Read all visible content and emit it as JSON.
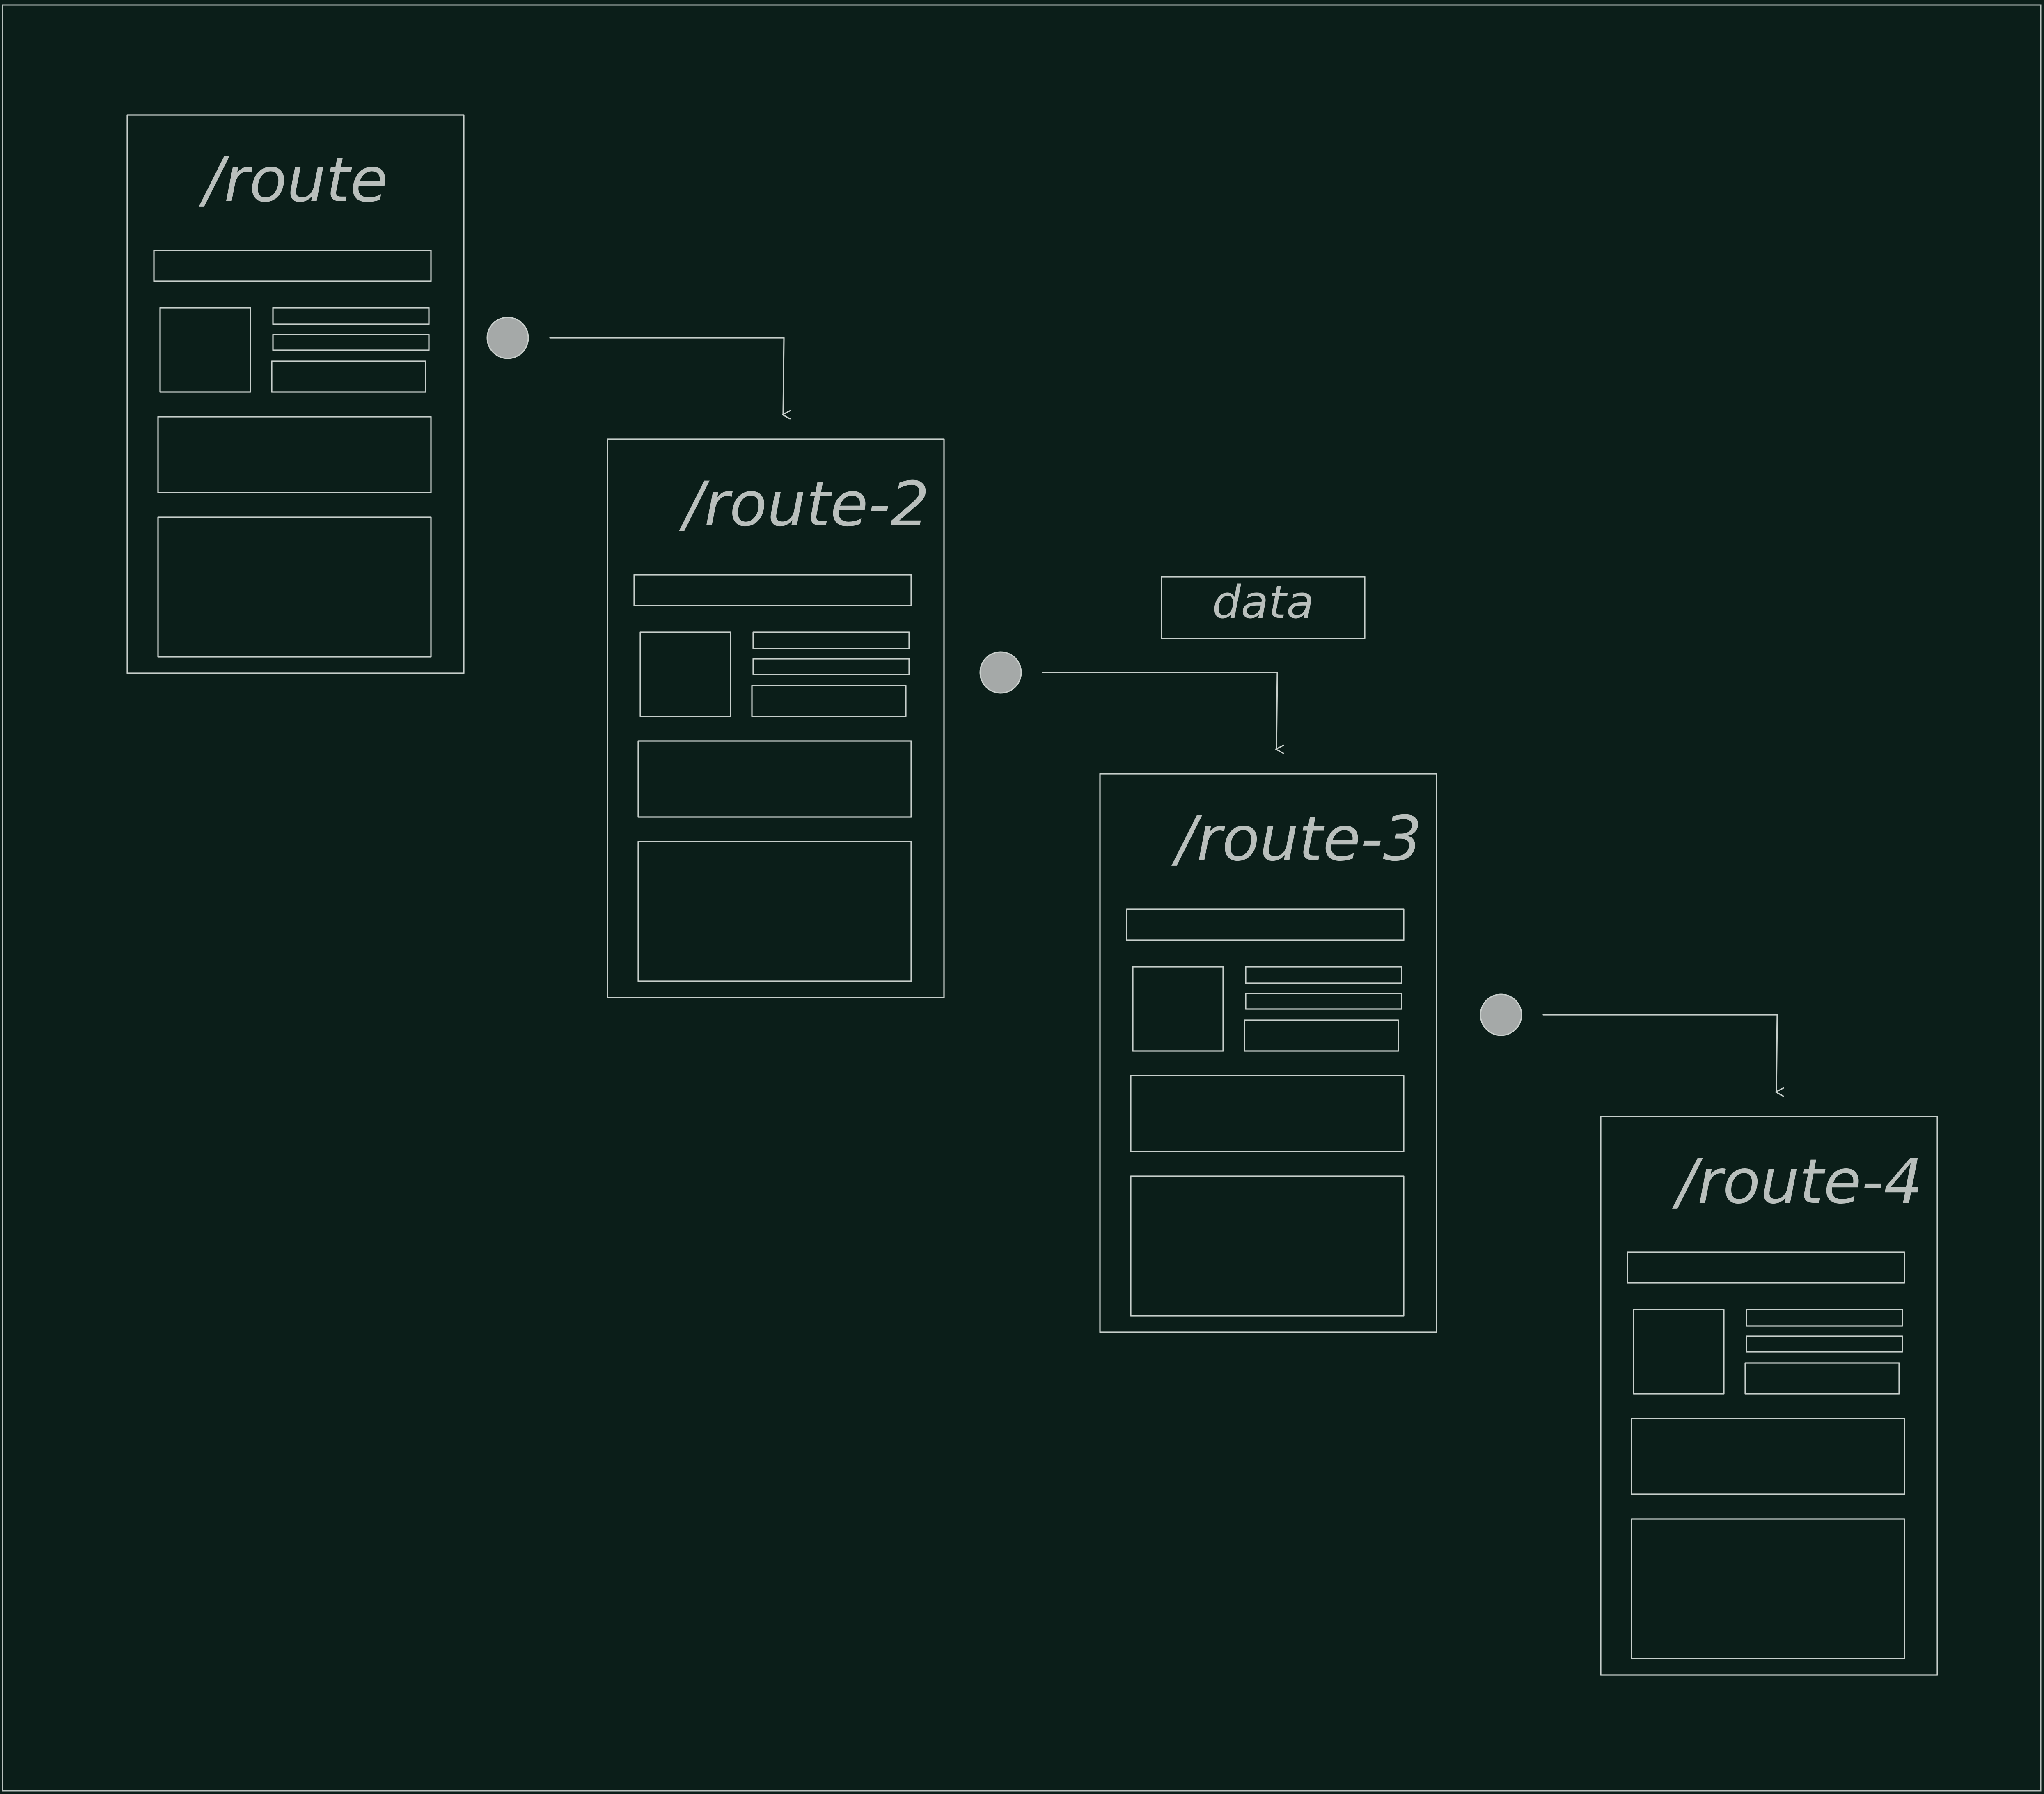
{
  "diagram": {
    "routes": [
      {
        "id": "route-1",
        "title": "/route"
      },
      {
        "id": "route-2",
        "title": "/route-2"
      },
      {
        "id": "route-3",
        "title": "/route-3"
      },
      {
        "id": "route-4",
        "title": "/route-4"
      }
    ],
    "edges": [
      {
        "from": "route-1",
        "to": "route-2",
        "label": ""
      },
      {
        "from": "route-2",
        "to": "route-3",
        "label": "data"
      },
      {
        "from": "route-3",
        "to": "route-4",
        "label": ""
      }
    ],
    "colors": {
      "background": "#0b1e19",
      "stroke": "#c7cfcb",
      "text": "#b9bfbc",
      "node_dot": "#a5a9a8"
    }
  }
}
